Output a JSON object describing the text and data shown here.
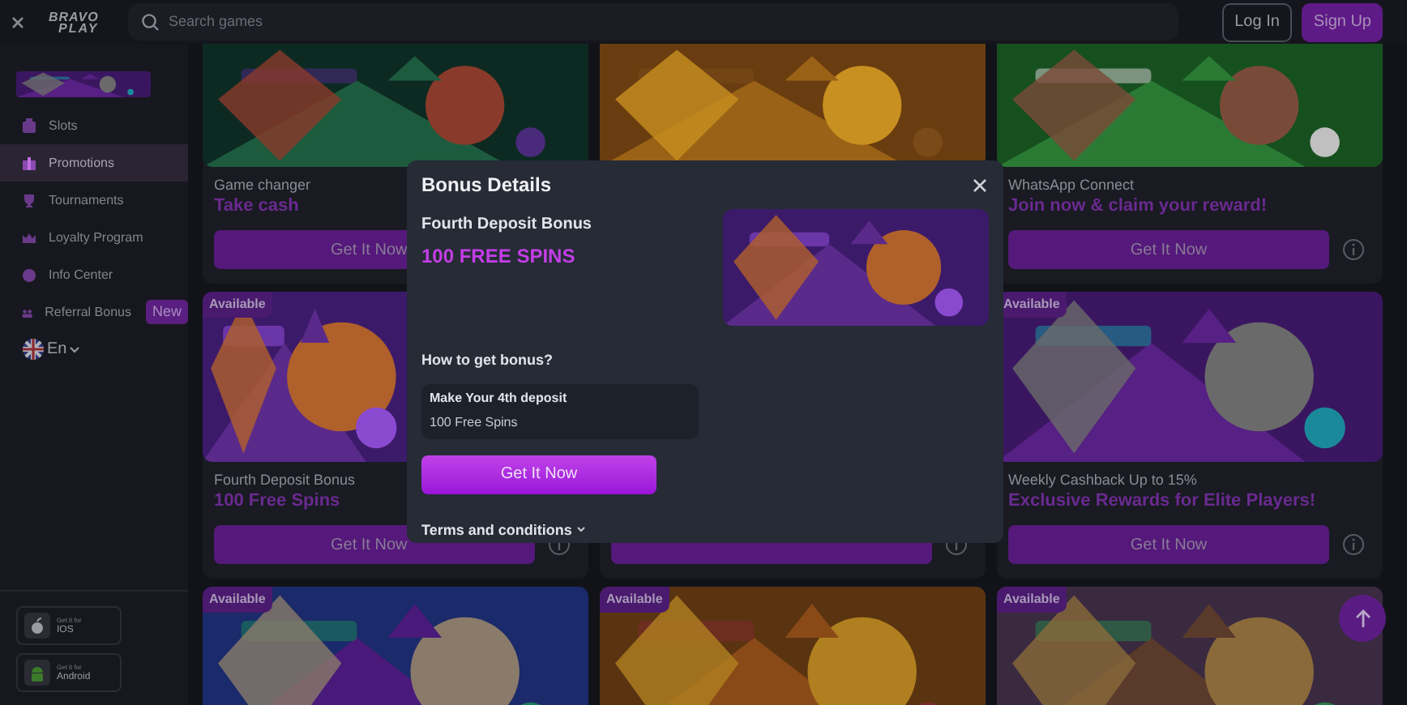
{
  "header": {
    "logo": [
      "BRAVO",
      "PLAY"
    ],
    "search": {
      "placeholder": "Search games"
    },
    "buttons": [
      {
        "label": "Log In",
        "kind": "outline"
      },
      {
        "label": "Sign Up",
        "kind": "primary"
      }
    ]
  },
  "sidebar": {
    "items": [
      {
        "label": "Slots",
        "selected": false
      },
      {
        "label": "Promotions",
        "selected": true
      },
      {
        "label": "Tournaments",
        "selected": false
      },
      {
        "label": "Loyalty Program",
        "selected": false
      },
      {
        "label": "Info Center",
        "selected": false
      },
      {
        "label": "Referral Bonus",
        "selected": false,
        "badge": "New"
      }
    ],
    "language": "En",
    "apps": [
      {
        "caption": "Get it for",
        "label": "IOS"
      },
      {
        "caption": "Get it for",
        "label": "Android"
      }
    ]
  },
  "promotions": [
    {
      "kind": "promo",
      "title": "Game changer",
      "subtitle": "Take cash",
      "button": "Get It Now"
    },
    {
      "kind": "promo"
    },
    {
      "kind": "promo",
      "title": "WhatsApp Connect",
      "subtitle": "Join now & claim your reward!",
      "button": "Get It Now",
      "info": true
    },
    {
      "kind": "promo",
      "badge": "Available",
      "title": "Fourth Deposit Bonus",
      "subtitle": "100 Free Spins",
      "button": "Get It Now",
      "info": true
    },
    {
      "kind": "promo",
      "button_strip": true,
      "info": true
    },
    {
      "kind": "promo",
      "badge": "Available",
      "title": "Weekly Cashback Up to 15%",
      "subtitle": "Exclusive Rewards for Elite Players!",
      "button": "Get It Now",
      "info": true
    },
    {
      "kind": "promo",
      "badge": "Available"
    },
    {
      "kind": "promo",
      "badge": "Available"
    },
    {
      "kind": "promo",
      "badge": "Available"
    }
  ],
  "modal": {
    "title": "Bonus Details",
    "bonus_name": "Fourth Deposit Bonus",
    "bonus_value": "100 FREE SPINS",
    "how_title": "How to get bonus?",
    "steps": [
      {
        "title": "Make Your 4th deposit",
        "detail": "100 Free Spins"
      }
    ],
    "button": "Get It Now",
    "terms": "Terms and conditions"
  }
}
